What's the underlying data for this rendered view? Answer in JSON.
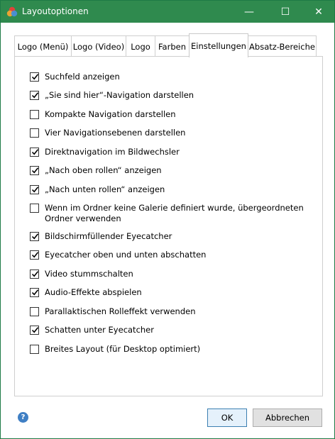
{
  "window": {
    "title": "Layoutoptionen",
    "controls": {
      "minimize": "—",
      "maximize": "☐",
      "close": "✕"
    }
  },
  "tabs": [
    {
      "label": "Logo (Menü)",
      "active": false
    },
    {
      "label": "Logo (Video)",
      "active": false
    },
    {
      "label": "Logo",
      "active": false
    },
    {
      "label": "Farben",
      "active": false
    },
    {
      "label": "Einstellungen",
      "active": true
    },
    {
      "label": "Absatz-Bereiche",
      "active": false
    }
  ],
  "options": [
    {
      "label": "Suchfeld anzeigen",
      "checked": true
    },
    {
      "label": "„Sie sind hier“-Navigation darstellen",
      "checked": true
    },
    {
      "label": "Kompakte Navigation darstellen",
      "checked": false
    },
    {
      "label": "Vier Navigationsebenen darstellen",
      "checked": false
    },
    {
      "label": "Direktnavigation im Bildwechsler",
      "checked": true
    },
    {
      "label": "„Nach oben rollen“ anzeigen",
      "checked": true
    },
    {
      "label": "„Nach unten rollen“ anzeigen",
      "checked": true
    },
    {
      "label": "Wenn im Ordner keine Galerie definiert wurde, übergeordneten Ordner verwenden",
      "checked": false
    },
    {
      "label": "Bildschirmfüllender Eyecatcher",
      "checked": true
    },
    {
      "label": "Eyecatcher oben und unten abschatten",
      "checked": true
    },
    {
      "label": "Video stummschalten",
      "checked": true
    },
    {
      "label": "Audio-Effekte abspielen",
      "checked": true
    },
    {
      "label": "Parallaktischen Rolleffekt verwenden",
      "checked": false
    },
    {
      "label": "Schatten unter Eyecatcher",
      "checked": true
    },
    {
      "label": "Breites Layout (für Desktop optimiert)",
      "checked": false
    }
  ],
  "footer": {
    "help_glyph": "?",
    "ok_label": "OK",
    "cancel_label": "Abbrechen"
  },
  "colors": {
    "titlebar": "#2f8a4e",
    "accent": "#3f7fc4"
  }
}
